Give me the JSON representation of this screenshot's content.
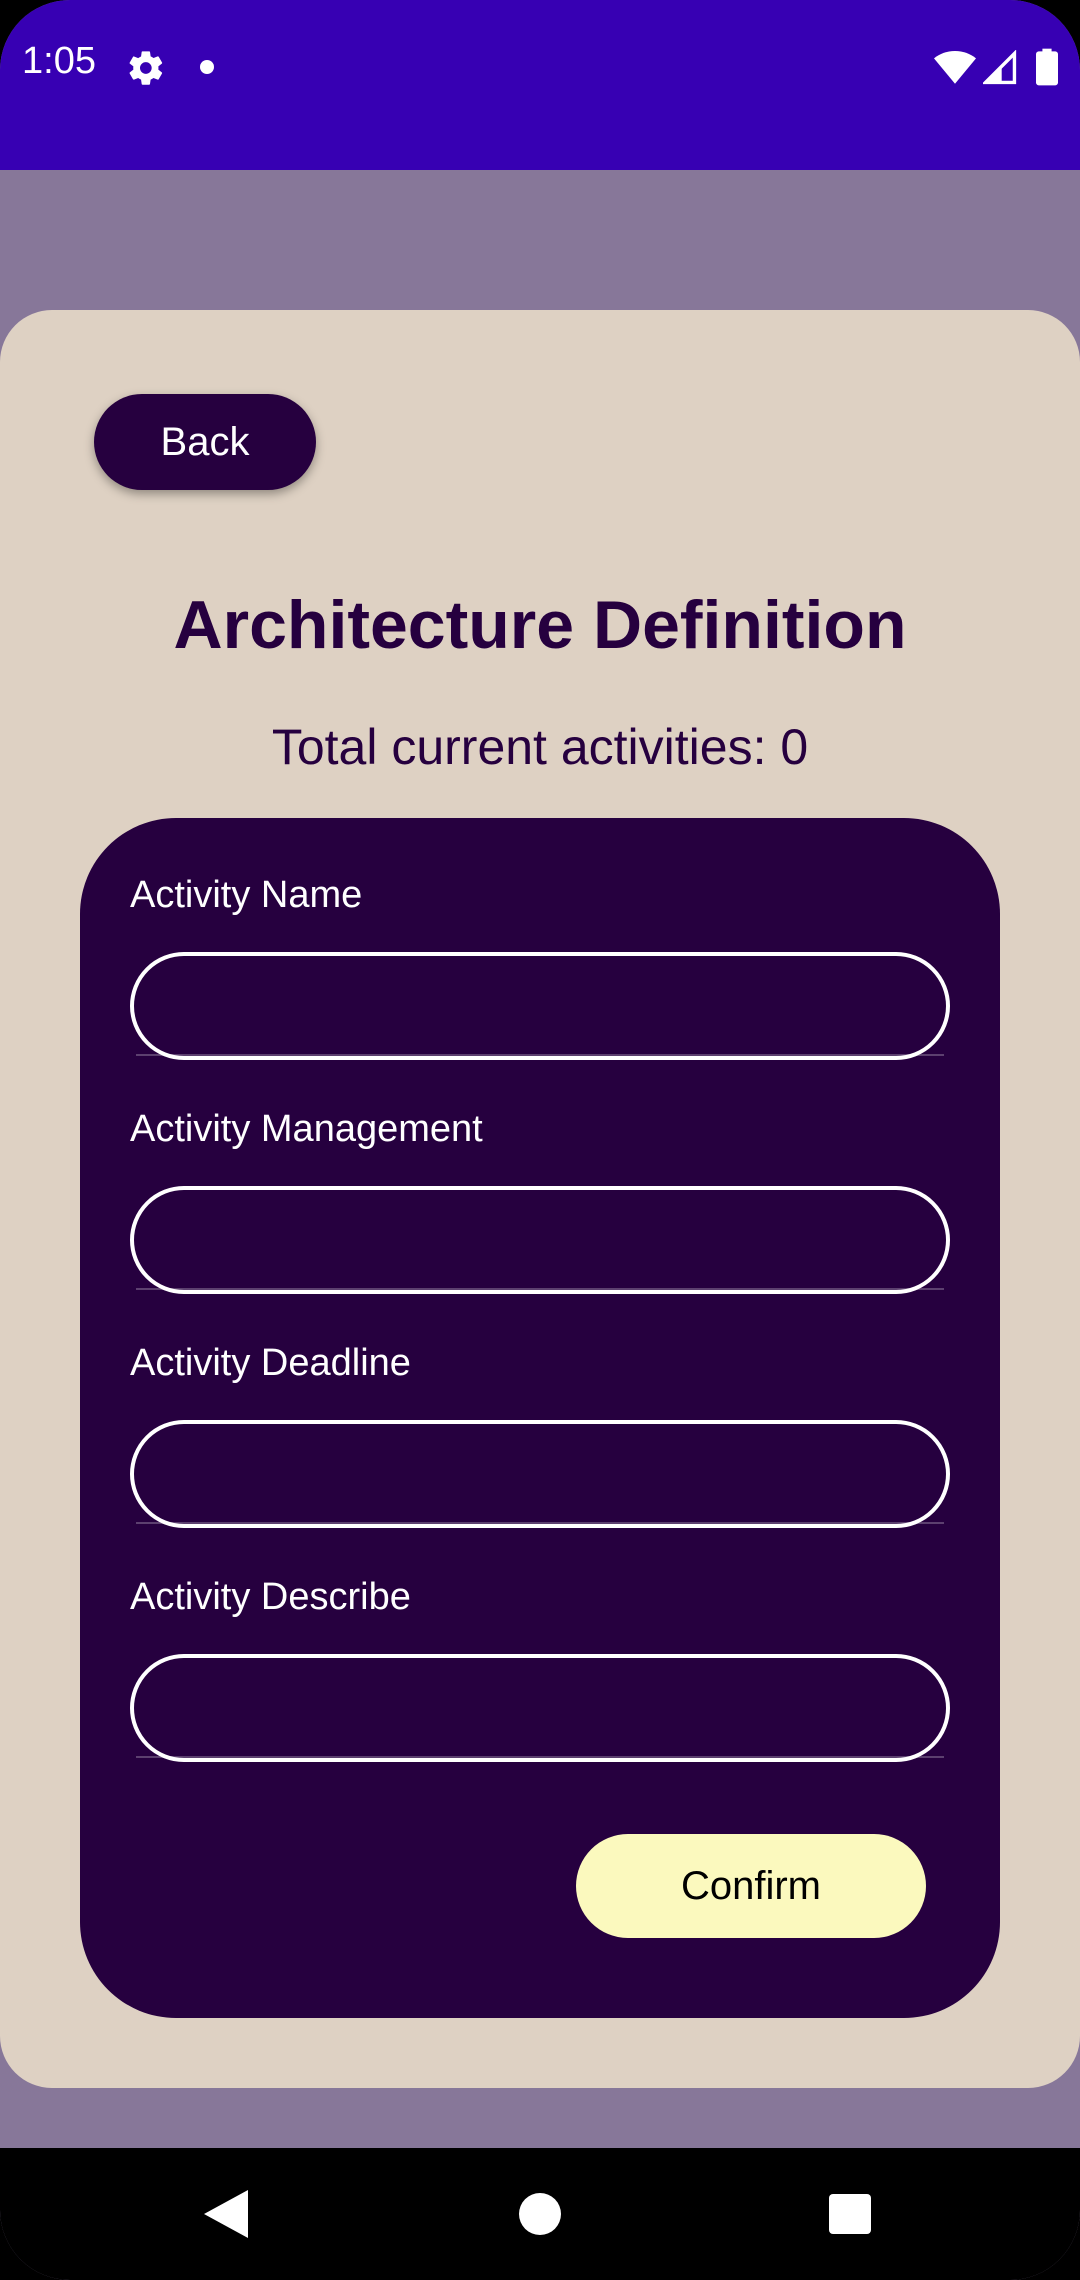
{
  "status_bar": {
    "time": "1:05",
    "icons": [
      "gear-icon",
      "notification-dot-icon",
      "wifi-icon",
      "signal-icon",
      "battery-icon"
    ]
  },
  "header": {
    "back_label": "Back",
    "title": "Architecture Definition",
    "activity_count_text": "Total current activities: 0"
  },
  "form": {
    "fields": [
      {
        "label": "Activity Name",
        "value": "",
        "placeholder": ""
      },
      {
        "label": "Activity Management",
        "value": "",
        "placeholder": ""
      },
      {
        "label": "Activity Deadline",
        "value": "",
        "placeholder": ""
      },
      {
        "label": "Activity Describe",
        "value": "",
        "placeholder": ""
      }
    ],
    "confirm_label": "Confirm"
  },
  "nav_bar": {
    "icons": [
      "back-triangle-icon",
      "home-circle-icon",
      "recents-square-icon"
    ]
  },
  "colors": {
    "status_bar": "#3700B3",
    "background": "#877799",
    "panel": "#DED1C3",
    "primary_dark": "#26003F",
    "confirm": "#FBF9BE"
  }
}
